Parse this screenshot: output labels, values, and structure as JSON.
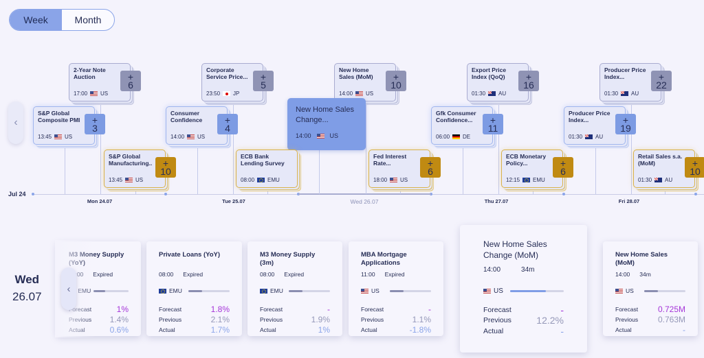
{
  "toggle": {
    "week": "Week",
    "month": "Month",
    "active": "week"
  },
  "colors": {
    "accent": "#7f9de6",
    "gold": "#c08a12",
    "gray": "#8f93b4",
    "forecast": "#a534d8",
    "actual": "#8aa4e8"
  },
  "timeline": {
    "start_label": "Jul 24",
    "days": [
      "Mon 24.07",
      "Tue 25.07",
      "Wed 26.07",
      "Thu 27.07",
      "Fri 28.07"
    ],
    "current_day": "Wed 26.07",
    "events": [
      {
        "title": "2-Year Note Auction",
        "time": "17:00",
        "country": "US",
        "flag": "us",
        "more": "6",
        "style": "gray"
      },
      {
        "title": "Corporate Service Price...",
        "time": "23:50",
        "country": "JP",
        "flag": "jp",
        "more": "5",
        "style": "gray"
      },
      {
        "title": "New Home Sales (MoM)",
        "time": "14:00",
        "country": "US",
        "flag": "us",
        "more": "10",
        "style": "gray"
      },
      {
        "title": "Export Price Index (QoQ)",
        "time": "01:30",
        "country": "AU",
        "flag": "au",
        "more": "16",
        "style": "gray"
      },
      {
        "title": "Producer Price Index...",
        "time": "01:30",
        "country": "AU",
        "flag": "au",
        "more": "22",
        "style": "gray"
      },
      {
        "title": "S&P Global Composite PMI",
        "time": "13:45",
        "country": "US",
        "flag": "us",
        "more": "3",
        "style": "blue"
      },
      {
        "title": "Consumer Confidence",
        "time": "14:00",
        "country": "US",
        "flag": "us",
        "more": "4",
        "style": "blue"
      },
      {
        "title": "New Home Sales Change...",
        "time": "14:00",
        "country": "US",
        "flag": "us",
        "more": "",
        "style": "sel"
      },
      {
        "title": "Gfk Consumer Confidence...",
        "time": "06:00",
        "country": "DE",
        "flag": "de",
        "more": "11",
        "style": "blue"
      },
      {
        "title": "Producer Price Index...",
        "time": "01:30",
        "country": "AU",
        "flag": "au",
        "more": "19",
        "style": "blue"
      },
      {
        "title": "S&P Global Manufacturing..",
        "time": "13:45",
        "country": "US",
        "flag": "us",
        "more": "10",
        "style": "gold"
      },
      {
        "title": "ECB Bank Lending Survey",
        "time": "08:00",
        "country": "EMU",
        "flag": "emu",
        "more": "",
        "style": "gold"
      },
      {
        "title": "Fed Interest Rate...",
        "time": "18:00",
        "country": "US",
        "flag": "us",
        "more": "6",
        "style": "gold"
      },
      {
        "title": "ECB Monetary Policy...",
        "time": "12:15",
        "country": "EMU",
        "flag": "emu",
        "more": "6",
        "style": "gold"
      },
      {
        "title": "Retail Sales s.a. (MoM)",
        "time": "01:30",
        "country": "AU",
        "flag": "au",
        "more": "10",
        "style": "gold"
      }
    ]
  },
  "day": {
    "weekday": "Wed",
    "date": "26.07"
  },
  "labels": {
    "forecast": "Forecast",
    "previous": "Previous",
    "actual": "Actual"
  },
  "cards": [
    {
      "title": "M3 Money Supply (YoY)",
      "time": "08:00",
      "status": "Expired",
      "country": "EMU",
      "flag": "emu",
      "progress": 0.33,
      "forecast": "1%",
      "previous": "1.4%",
      "actual": "0.6%"
    },
    {
      "title": "Private Loans (YoY)",
      "time": "08:00",
      "status": "Expired",
      "country": "EMU",
      "flag": "emu",
      "progress": 0.33,
      "forecast": "1.8%",
      "previous": "2.1%",
      "actual": "1.7%"
    },
    {
      "title": "M3 Money Supply (3m)",
      "time": "08:00",
      "status": "Expired",
      "country": "EMU",
      "flag": "emu",
      "progress": 0.33,
      "forecast": "-",
      "previous": "1.9%",
      "actual": "1%"
    },
    {
      "title": "MBA Mortgage Applications",
      "time": "11:00",
      "status": "Expired",
      "country": "US",
      "flag": "us",
      "progress": 0.33,
      "forecast": "-",
      "previous": "1.1%",
      "actual": "-1.8%"
    },
    {
      "title": "New Home Sales Change (MoM)",
      "time": "14:00",
      "status": "34m",
      "country": "US",
      "flag": "us",
      "progress": 0.67,
      "forecast": "-",
      "previous": "12.2%",
      "actual": "-"
    },
    {
      "title": "New Home Sales (MoM)",
      "time": "14:00",
      "status": "34m",
      "country": "US",
      "flag": "us",
      "progress": 0.33,
      "forecast": "0.725M",
      "previous": "0.763M",
      "actual": "-"
    }
  ]
}
